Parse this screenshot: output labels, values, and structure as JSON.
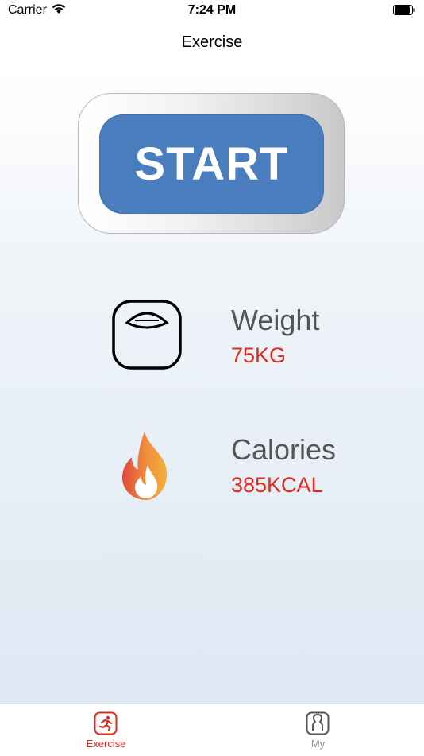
{
  "status_bar": {
    "carrier": "Carrier",
    "time": "7:24 PM"
  },
  "nav": {
    "title": "Exercise"
  },
  "start_label": "START",
  "stats": [
    {
      "label": "Weight",
      "value": "75KG",
      "icon": "scale-icon"
    },
    {
      "label": "Calories",
      "value": "385KCAL",
      "icon": "flame-icon"
    }
  ],
  "tabs": [
    {
      "label": "Exercise",
      "icon": "running-icon",
      "active": true
    },
    {
      "label": "My",
      "icon": "user-icon",
      "active": false
    }
  ],
  "colors": {
    "accent": "#e02a1c",
    "start_button": "#4a7dbd",
    "tab_inactive": "#8e8e93"
  }
}
